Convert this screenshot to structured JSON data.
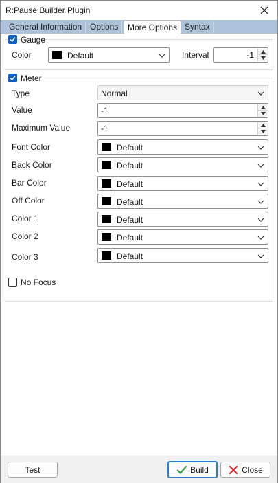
{
  "window": {
    "title": "R:Pause Builder Plugin"
  },
  "tabs": [
    {
      "label": "General Information"
    },
    {
      "label": "Options"
    },
    {
      "label": "More Options"
    },
    {
      "label": "Syntax"
    }
  ],
  "gauge": {
    "label": "Gauge",
    "checked": true,
    "color_label": "Color",
    "color_value": "Default",
    "interval_label": "Interval",
    "interval_value": "-1"
  },
  "meter": {
    "label": "Meter",
    "checked": true,
    "type_label": "Type",
    "type_value": "Normal",
    "value_label": "Value",
    "value_value": "-1",
    "max_label": "Maximum Value",
    "max_value": "-1",
    "colors": [
      {
        "label": "Font Color",
        "value": "Default"
      },
      {
        "label": "Back Color",
        "value": "Default"
      },
      {
        "label": "Bar Color",
        "value": "Default"
      },
      {
        "label": "Off Color",
        "value": "Default"
      },
      {
        "label": "Color 1",
        "value": "Default"
      },
      {
        "label": "Color 2",
        "value": "Default"
      },
      {
        "label": "Color 3",
        "value": "Default"
      }
    ]
  },
  "no_focus": {
    "label": "No Focus",
    "checked": false
  },
  "buttons": {
    "test": "Test",
    "build": "Build",
    "close": "Close"
  },
  "style": {
    "accent": "#1060c8",
    "tab_strip": "#aec3d9",
    "swatch_color": "#000000"
  }
}
